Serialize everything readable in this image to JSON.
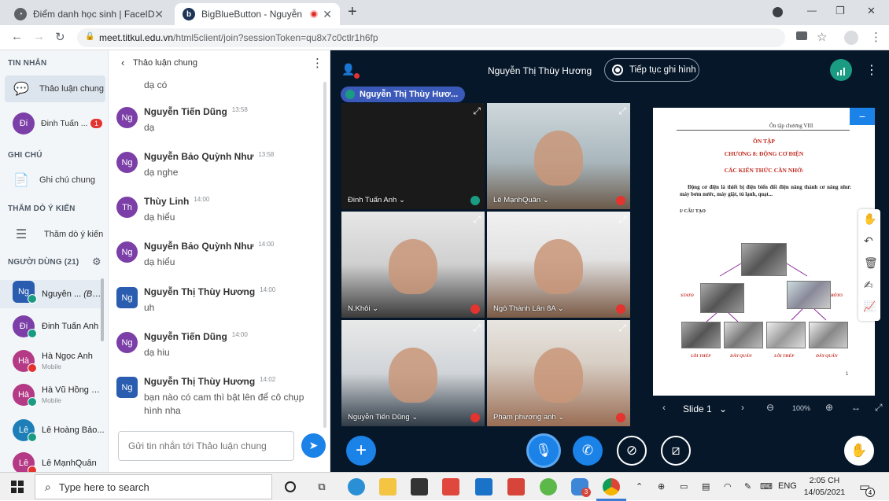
{
  "browser": {
    "tabs": [
      {
        "title": "Điểm danh học sinh | FaceID",
        "active": false
      },
      {
        "title": "BigBlueButton - Nguyễn Thị",
        "active": true
      }
    ],
    "url_host": "meet.titkul.edu.vn",
    "url_path": "/html5client/join?sessionToken=qu8x7c0ctlr1h6fp",
    "new_tab": "+",
    "minimize": "—",
    "restore": "❐",
    "close": "✕"
  },
  "userpanel": {
    "messages_header": "TIN NHẮN",
    "public_chat": "Thảo luận chung",
    "private_chat_name": "Đinh Tuấn ...",
    "private_chat_initials": "Đi",
    "private_unread": "1",
    "notes_header": "GHI CHÚ",
    "shared_notes": "Ghi chú chung",
    "polls_header": "THĂM DÒ Ý KIẾN",
    "poll_item": "Thăm dò ý kiến",
    "users_header": "NGƯỜI DÙNG (21)",
    "users": [
      {
        "initials": "Ng",
        "name": "Nguyễn ...",
        "you": "(Bạn)",
        "sub": "",
        "color": "#2a5db0",
        "status": "mic"
      },
      {
        "initials": "Đi",
        "name": "Đinh Tuấn Anh",
        "you": "",
        "sub": "",
        "color": "#7b3fa7",
        "status": "listen"
      },
      {
        "initials": "Hà",
        "name": "Hà Ngọc Anh",
        "you": "",
        "sub": "Mobile",
        "color": "#b43a86",
        "status": "muted"
      },
      {
        "initials": "Hà",
        "name": "Hà Vũ Hồng H...",
        "you": "",
        "sub": "Mobile",
        "color": "#b43a86",
        "status": "listen"
      },
      {
        "initials": "Lê",
        "name": "Lê Hoàng Bảo...",
        "you": "",
        "sub": "",
        "color": "#1e7fb8",
        "status": "listen"
      },
      {
        "initials": "Lê",
        "name": "Lê MạnhQuân",
        "you": "",
        "sub": "",
        "color": "#b43a86",
        "status": "muted"
      }
    ]
  },
  "chat": {
    "title": "Thảo luận chung",
    "partial_top": "dạ có",
    "messages": [
      {
        "initials": "Ng",
        "name": "Nguyễn Tiến Dũng",
        "time": "13:58",
        "text": "dạ",
        "color": "#7b3fa7"
      },
      {
        "initials": "Ng",
        "name": "Nguyễn Bảo Quỳnh Như",
        "time": "13:58",
        "text": "dạ nghe",
        "color": "#7b3fa7"
      },
      {
        "initials": "Th",
        "name": "Thùy Linh",
        "time": "14:00",
        "text": "dạ hiểu",
        "color": "#7b3fa7"
      },
      {
        "initials": "Ng",
        "name": "Nguyễn Bảo Quỳnh Như",
        "time": "14:00",
        "text": "dạ hiểu",
        "color": "#7b3fa7"
      },
      {
        "initials": "Ng",
        "name": "Nguyễn Thị Thùy Hương",
        "time": "14:00",
        "text": "uh",
        "color": "#2a5db0"
      },
      {
        "initials": "Ng",
        "name": "Nguyễn Tiến Dũng",
        "time": "14:00",
        "text": "dạ hiu",
        "color": "#7b3fa7"
      },
      {
        "initials": "Ng",
        "name": "Nguyễn Thị Thùy Hương",
        "time": "14:02",
        "text": "bạn nào có cam thì bật lên để cô chụp hình nha",
        "color": "#2a5db0"
      }
    ],
    "input_placeholder": "Gửi tin nhắn tới Thảo luận chung"
  },
  "meeting": {
    "presenter_name": "Nguyễn Thị Thùy Hương",
    "record_label": "Tiếp tục ghi hình",
    "talking_indicator": "Nguyễn Thị Thùy Hươ...",
    "videos": [
      {
        "name": "Đinh Tuấn Anh",
        "status": "listen"
      },
      {
        "name": "Lê MạnhQuân",
        "status": "muted"
      },
      {
        "name": "N.Khôi",
        "status": "muted"
      },
      {
        "name": "Ngô Thành Lân 8A",
        "status": "muted"
      },
      {
        "name": "Nguyễn Tiến Dũng",
        "status": "muted"
      },
      {
        "name": "Phạm phương anh",
        "status": "muted"
      }
    ]
  },
  "slide": {
    "header_right": "Ôn tập chương VIII",
    "title": "ÔN TẬP",
    "chapter": "CHƯƠNG 8: ĐỘNG CƠ ĐIỆN",
    "remember": "CÁC KIẾN THỨC CẦN NHỚ:",
    "body": "Động cơ điện là thiết bị điện biến đổi điện năng thành cơ năng như: máy bơm nước, máy giặt, tủ lạnh, quạt...",
    "section": "I/ CẤU TẠO",
    "label_stato": "STATO",
    "label_roto": "RÔTO",
    "label_loi_thep": "LÕI THÉP",
    "label_day_quan": "DÂY QUẤN",
    "page_number": "1",
    "slide_label": "Slide 1",
    "zoom": "100%"
  },
  "taskbar": {
    "search_placeholder": "Type here to search",
    "lang": "ENG",
    "time": "2:05 CH",
    "date": "14/05/2021",
    "notif_count": "4",
    "app_badge": "3"
  }
}
